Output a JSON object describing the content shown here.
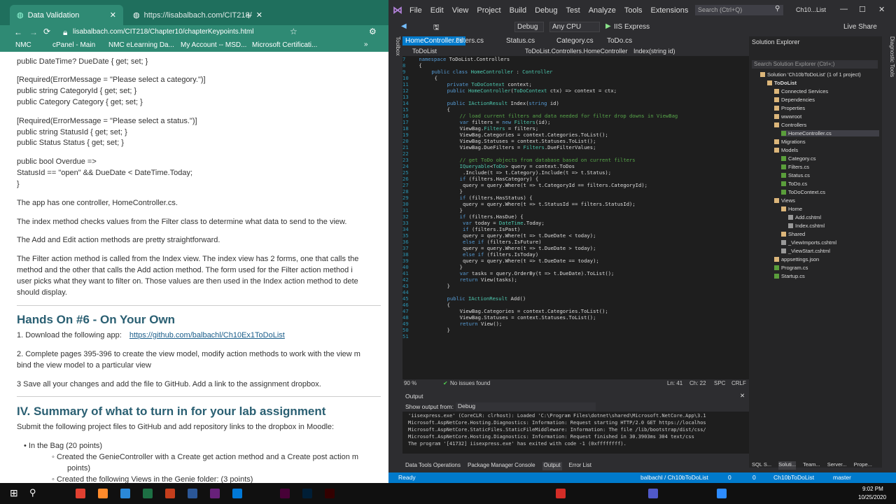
{
  "browser": {
    "tabs": [
      {
        "title": "Data Validation",
        "active": true
      },
      {
        "title": "https://lisabalbach.com/CIT218/"
      }
    ],
    "url": "lisabalbach.com/CIT218/Chapter10/chapterKeypoints.html",
    "bookmarks": [
      "NMC",
      "cPanel - Main",
      "NMC eLearning Da...",
      "My Account -- MSD...",
      "Microsoft Certificati..."
    ],
    "content": [
      {
        "k": "t",
        "text": "public DateTime? DueDate { get; set; }"
      },
      {
        "k": "t",
        "text": "[Required(ErrorMessage = \"Please select a category.\")]"
      },
      {
        "k": "t",
        "text": "public string CategoryId { get; set; }"
      },
      {
        "k": "t",
        "text": "public Category Category { get; set; }"
      },
      {
        "k": "t",
        "text": "[Required(ErrorMessage = \"Please select a status.\")]"
      },
      {
        "k": "t",
        "text": "public string StatusId { get; set; }"
      },
      {
        "k": "t",
        "text": "public Status Status { get; set; }"
      },
      {
        "k": "t",
        "text": "public bool Overdue =>"
      },
      {
        "k": "t",
        "text": "StatusId == \"open\" && DueDate < DateTime.Today;"
      },
      {
        "k": "t",
        "text": "}"
      },
      {
        "k": "t",
        "text": "The app has one controller, HomeController.cs."
      },
      {
        "k": "t",
        "text": "The index method checks values from the Filter class to determine what data to send to the view."
      },
      {
        "k": "t",
        "text": " The Add and Edit action methods are pretty straightforward."
      },
      {
        "k": "t",
        "text": "The Filter action method is called from the Index view.   The index view has 2 forms, one that calls the"
      },
      {
        "k": "t",
        "text": "method and the other that calls the Add action method.    The form used for the Filter action method i"
      },
      {
        "k": "t",
        "text": "user picks what they want to filter on.    Those values are then used in the Index action method to dete"
      },
      {
        "k": "t",
        "text": "should display."
      },
      {
        "k": "h",
        "text": "Hands On #6 - On Your Own"
      },
      {
        "k": "t",
        "text": "1. Download the following app:"
      },
      {
        "k": "t",
        "text": "2. Complete pages 395-396 to create the view model, modify action methods to work with the view m"
      },
      {
        "k": "t",
        "text": "bind the view model to a particular view"
      },
      {
        "k": "t",
        "text": "3 Save all your changes and add the file to GitHub. Add a link to the assignment dropbox."
      },
      {
        "k": "h",
        "text": "IV. Summary of what to turn in for your lab assignment"
      },
      {
        "k": "t",
        "text": "Submit the following project files to GitHub and add repository links to the dropbox in Moodle:"
      },
      {
        "k": "t",
        "text": "• In the Bag (20 points)"
      },
      {
        "k": "t",
        "text": "◦ Created the GenieController with a Create get action method and a Create post action m"
      },
      {
        "k": "t",
        "text": "points)"
      },
      {
        "k": "t",
        "text": "◦ Created the following Views in the Genie folder: (3 points)"
      }
    ],
    "link": "https://github.com/balbachl/Ch10Ex1ToDoList"
  },
  "vs": {
    "menu": [
      "File",
      "Edit",
      "View",
      "Project",
      "Build",
      "Debug",
      "Test",
      "Analyze",
      "Tools",
      "Extensions",
      "Window",
      "Help"
    ],
    "search_placeholder": "Search (Ctrl+Q)",
    "solution_short": "Ch10...List",
    "live_share": "Live Share",
    "config": "Debug",
    "platform": "Any CPU",
    "run": "IIS Express",
    "doc_tabs": [
      "HomeController.cs",
      "Filters.cs",
      "Status.cs",
      "Category.cs",
      "ToDo.cs"
    ],
    "nav": [
      "ToDoList",
      "ToDoList.Controllers.HomeController",
      "Index(string id)"
    ],
    "code": [
      {
        "n": "7",
        "t": "namespace ToDoList.Controllers",
        "i": 0
      },
      {
        "n": "8",
        "t": "{",
        "i": 0
      },
      {
        "n": "9",
        "t": "public class HomeController : Controller",
        "i": 1
      },
      {
        "n": "10",
        "t": "{",
        "i": 1
      },
      {
        "n": "11",
        "t": "private ToDoContext context;",
        "i": 2
      },
      {
        "n": "12",
        "t": "public HomeController(ToDoContext ctx) => context = ctx;",
        "i": 2
      },
      {
        "n": "13",
        "t": "",
        "i": 2
      },
      {
        "n": "14",
        "t": "public IActionResult Index(string id)",
        "i": 2
      },
      {
        "n": "15",
        "t": "{",
        "i": 2
      },
      {
        "n": "16",
        "t": "// load current filters and data needed for filter drop downs in ViewBag",
        "i": 3
      },
      {
        "n": "17",
        "t": "var filters = new Filters(id);",
        "i": 3
      },
      {
        "n": "18",
        "t": "ViewBag.Filters = filters;",
        "i": 3
      },
      {
        "n": "19",
        "t": "ViewBag.Categories = context.Categories.ToList();",
        "i": 3
      },
      {
        "n": "20",
        "t": "ViewBag.Statuses = context.Statuses.ToList();",
        "i": 3
      },
      {
        "n": "21",
        "t": "ViewBag.DueFilters = Filters.DueFilterValues;",
        "i": 3
      },
      {
        "n": "22",
        "t": "",
        "i": 3
      },
      {
        "n": "23",
        "t": "// get ToDo objects from database based on current filters",
        "i": 3
      },
      {
        "n": "24",
        "t": "IQueryable<ToDo> query = context.ToDos",
        "i": 3
      },
      {
        "n": "25",
        "t": "    .Include(t => t.Category).Include(t => t.Status);",
        "i": 3
      },
      {
        "n": "26",
        "t": "if (filters.HasCategory) {",
        "i": 3
      },
      {
        "n": "27",
        "t": "    query = query.Where(t => t.CategoryId == filters.CategoryId);",
        "i": 3
      },
      {
        "n": "28",
        "t": "}",
        "i": 3
      },
      {
        "n": "29",
        "t": "if (filters.HasStatus) {",
        "i": 3
      },
      {
        "n": "30",
        "t": "    query = query.Where(t => t.StatusId == filters.StatusId);",
        "i": 3
      },
      {
        "n": "31",
        "t": "}",
        "i": 3
      },
      {
        "n": "32",
        "t": "if (filters.HasDue) {",
        "i": 3
      },
      {
        "n": "33",
        "t": "    var today = DateTime.Today;",
        "i": 3
      },
      {
        "n": "34",
        "t": "    if (filters.IsPast)",
        "i": 3
      },
      {
        "n": "35",
        "t": "        query = query.Where(t => t.DueDate < today);",
        "i": 3
      },
      {
        "n": "36",
        "t": "    else if (filters.IsFuture)",
        "i": 3
      },
      {
        "n": "37",
        "t": "        query = query.Where(t => t.DueDate > today);",
        "i": 3
      },
      {
        "n": "38",
        "t": "    else if (filters.IsToday)",
        "i": 3
      },
      {
        "n": "39",
        "t": "        query = query.Where(t => t.DueDate == today);",
        "i": 3
      },
      {
        "n": "40",
        "t": "}",
        "i": 3
      },
      {
        "n": "41",
        "t": "var tasks = query.OrderBy(t => t.DueDate).ToList();",
        "i": 3
      },
      {
        "n": "42",
        "t": "return View(tasks);",
        "i": 3
      },
      {
        "n": "43",
        "t": "}",
        "i": 2
      },
      {
        "n": "44",
        "t": "",
        "i": 2
      },
      {
        "n": "45",
        "t": "public IActionResult Add()",
        "i": 2
      },
      {
        "n": "46",
        "t": "{",
        "i": 2
      },
      {
        "n": "47",
        "t": "ViewBag.Categories = context.Categories.ToList();",
        "i": 3
      },
      {
        "n": "48",
        "t": "ViewBag.Statuses = context.Statuses.ToList();",
        "i": 3
      },
      {
        "n": "49",
        "t": "return View();",
        "i": 3
      },
      {
        "n": "50",
        "t": "}",
        "i": 2
      },
      {
        "n": "51",
        "t": "",
        "i": 2
      }
    ],
    "editor_status": {
      "zoom": "90 %",
      "issues": "No issues found",
      "ln": "Ln: 41",
      "ch": "Ch: 22",
      "spc": "SPC",
      "crlf": "CRLF"
    },
    "solution_explorer": {
      "title": "Solution Explorer",
      "search": "Search Solution Explorer (Ctrl+;)",
      "items": [
        {
          "text": "Solution 'Ch10bToDoList' (1 of 1 project)",
          "lvl": 0
        },
        {
          "text": "ToDoList",
          "lvl": 1,
          "bold": true
        },
        {
          "text": "Connected Services",
          "lvl": 2
        },
        {
          "text": "Dependencies",
          "lvl": 2
        },
        {
          "text": "Properties",
          "lvl": 2
        },
        {
          "text": "wwwroot",
          "lvl": 2
        },
        {
          "text": "Controllers",
          "lvl": 2
        },
        {
          "text": "HomeController.cs",
          "lvl": 3,
          "sel": true
        },
        {
          "text": "Migrations",
          "lvl": 2
        },
        {
          "text": "Models",
          "lvl": 2
        },
        {
          "text": "Category.cs",
          "lvl": 3
        },
        {
          "text": "Filters.cs",
          "lvl": 3
        },
        {
          "text": "Status.cs",
          "lvl": 3
        },
        {
          "text": "ToDo.cs",
          "lvl": 3
        },
        {
          "text": "ToDoContext.cs",
          "lvl": 3
        },
        {
          "text": "Views",
          "lvl": 2
        },
        {
          "text": "Home",
          "lvl": 3
        },
        {
          "text": "Add.cshtml",
          "lvl": 4
        },
        {
          "text": "Index.cshtml",
          "lvl": 4
        },
        {
          "text": "Shared",
          "lvl": 3
        },
        {
          "text": "_ViewImports.cshtml",
          "lvl": 3
        },
        {
          "text": "_ViewStart.cshtml",
          "lvl": 3
        },
        {
          "text": "appsettings.json",
          "lvl": 2
        },
        {
          "text": "Program.cs",
          "lvl": 2
        },
        {
          "text": "Startup.cs",
          "lvl": 2
        }
      ],
      "bottom_tabs": [
        "SQL S...",
        "Soluti...",
        "Team...",
        "Server...",
        "Prope..."
      ]
    },
    "output": {
      "title": "Output",
      "from_label": "Show output from:",
      "from_value": "Debug",
      "lines": [
        "'iisexpress.exe' (CoreCLR: clrhost): Loaded 'C:\\Program Files\\dotnet\\shared\\Microsoft.NetCore.App\\3.1",
        "Microsoft.AspNetCore.Hosting.Diagnostics: Information: Request starting HTTP/2.0 GET https://localhos",
        "Microsoft.AspNetCore.StaticFiles.StaticFileMiddleware: Information: The file /lib/bootstrap/dist/css/",
        "Microsoft.AspNetCore.Hosting.Diagnostics: Information: Request finished in 30.3903ms 304 text/css",
        "The program '[41732] iisexpress.exe' has exited with code -1 (0xffffffff)."
      ],
      "tabs": [
        "Data Tools Operations",
        "Package Manager Console",
        "Output",
        "Error List"
      ]
    },
    "statusbar": {
      "ready": "Ready",
      "repo": "balbachl / Ch10bToDoList",
      "errors": "0",
      "warnings": "0",
      "branch_repo": "Ch10bToDoList",
      "branch": "master"
    }
  },
  "taskbar": {
    "time": "9:02 PM",
    "date": "10/25/2020"
  }
}
